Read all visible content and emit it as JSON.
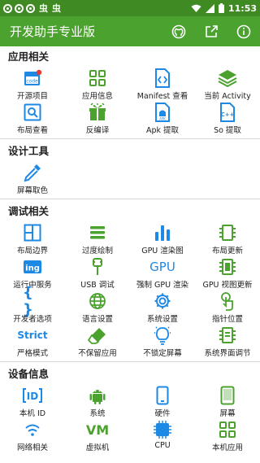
{
  "status_bar": {
    "time": "11:53",
    "icons": [
      "circle-icon",
      "circle-icon",
      "circle-icon",
      "bug-icon",
      "bug-icon",
      "wifi-icon",
      "signal-icon",
      "battery-icon"
    ]
  },
  "app_bar": {
    "title": "开发助手专业版",
    "actions": [
      "github-icon",
      "share-icon",
      "info-icon"
    ]
  },
  "colors": {
    "primary": "#4ca22f",
    "primary_dark": "#3f8a22",
    "icon_green": "#4ca22f",
    "icon_blue": "#1e88e5"
  },
  "sections": [
    {
      "title": "应用相关",
      "items": [
        {
          "label": "开源项目",
          "icon": "code-icon"
        },
        {
          "label": "应用信息",
          "icon": "apps-grid-icon"
        },
        {
          "label": "Manifest 查看",
          "icon": "manifest-icon"
        },
        {
          "label": "当前 Activity",
          "icon": "layers-icon"
        },
        {
          "label": "布局查看",
          "icon": "layout-search-icon"
        },
        {
          "label": "反编译",
          "icon": "gift-icon"
        },
        {
          "label": "Apk 提取",
          "icon": "apk-file-icon"
        },
        {
          "label": "So 提取",
          "icon": "cpp-file-icon"
        }
      ]
    },
    {
      "title": "设计工具",
      "items": [
        {
          "label": "屏幕取色",
          "icon": "eyedropper-icon"
        }
      ]
    },
    {
      "title": "调试相关",
      "items": [
        {
          "label": "布局边界",
          "icon": "bounds-icon"
        },
        {
          "label": "过度绘制",
          "icon": "overdraw-icon"
        },
        {
          "label": "GPU 渲染图",
          "icon": "bar-chart-icon"
        },
        {
          "label": "布局更新",
          "icon": "layout-update-icon"
        },
        {
          "label": "运行中服务",
          "icon": "ing-icon",
          "text": "ing"
        },
        {
          "label": "USB 调试",
          "icon": "usb-icon"
        },
        {
          "label": "强制 GPU 渲染",
          "icon": "gpu-icon",
          "text": "GPU"
        },
        {
          "label": "GPU 视图更新",
          "icon": "gpu-view-icon"
        },
        {
          "label": "开发者选项",
          "icon": "braces-icon",
          "text": "{ }"
        },
        {
          "label": "语言设置",
          "icon": "globe-icon"
        },
        {
          "label": "系统设置",
          "icon": "gear-icon"
        },
        {
          "label": "指针位置",
          "icon": "touch-icon"
        },
        {
          "label": "严格模式",
          "icon": "strict-icon",
          "text": "Strict"
        },
        {
          "label": "不保留应用",
          "icon": "eraser-icon"
        },
        {
          "label": "不锁定屏幕",
          "icon": "bulb-icon"
        },
        {
          "label": "系统界面调节",
          "icon": "tuner-icon"
        }
      ]
    },
    {
      "title": "设备信息",
      "items": [
        {
          "label": "本机 ID",
          "icon": "id-icon",
          "text": "ID"
        },
        {
          "label": "系统",
          "icon": "android-icon"
        },
        {
          "label": "硬件",
          "icon": "phone-icon"
        },
        {
          "label": "屏幕",
          "icon": "screen-icon"
        },
        {
          "label": "网络相关",
          "icon": "wifi-icon"
        },
        {
          "label": "虚拟机",
          "icon": "vm-icon",
          "text": "VM"
        },
        {
          "label": "CPU",
          "icon": "cpu-icon"
        },
        {
          "label": "本机应用",
          "icon": "apps-icon"
        }
      ]
    }
  ]
}
